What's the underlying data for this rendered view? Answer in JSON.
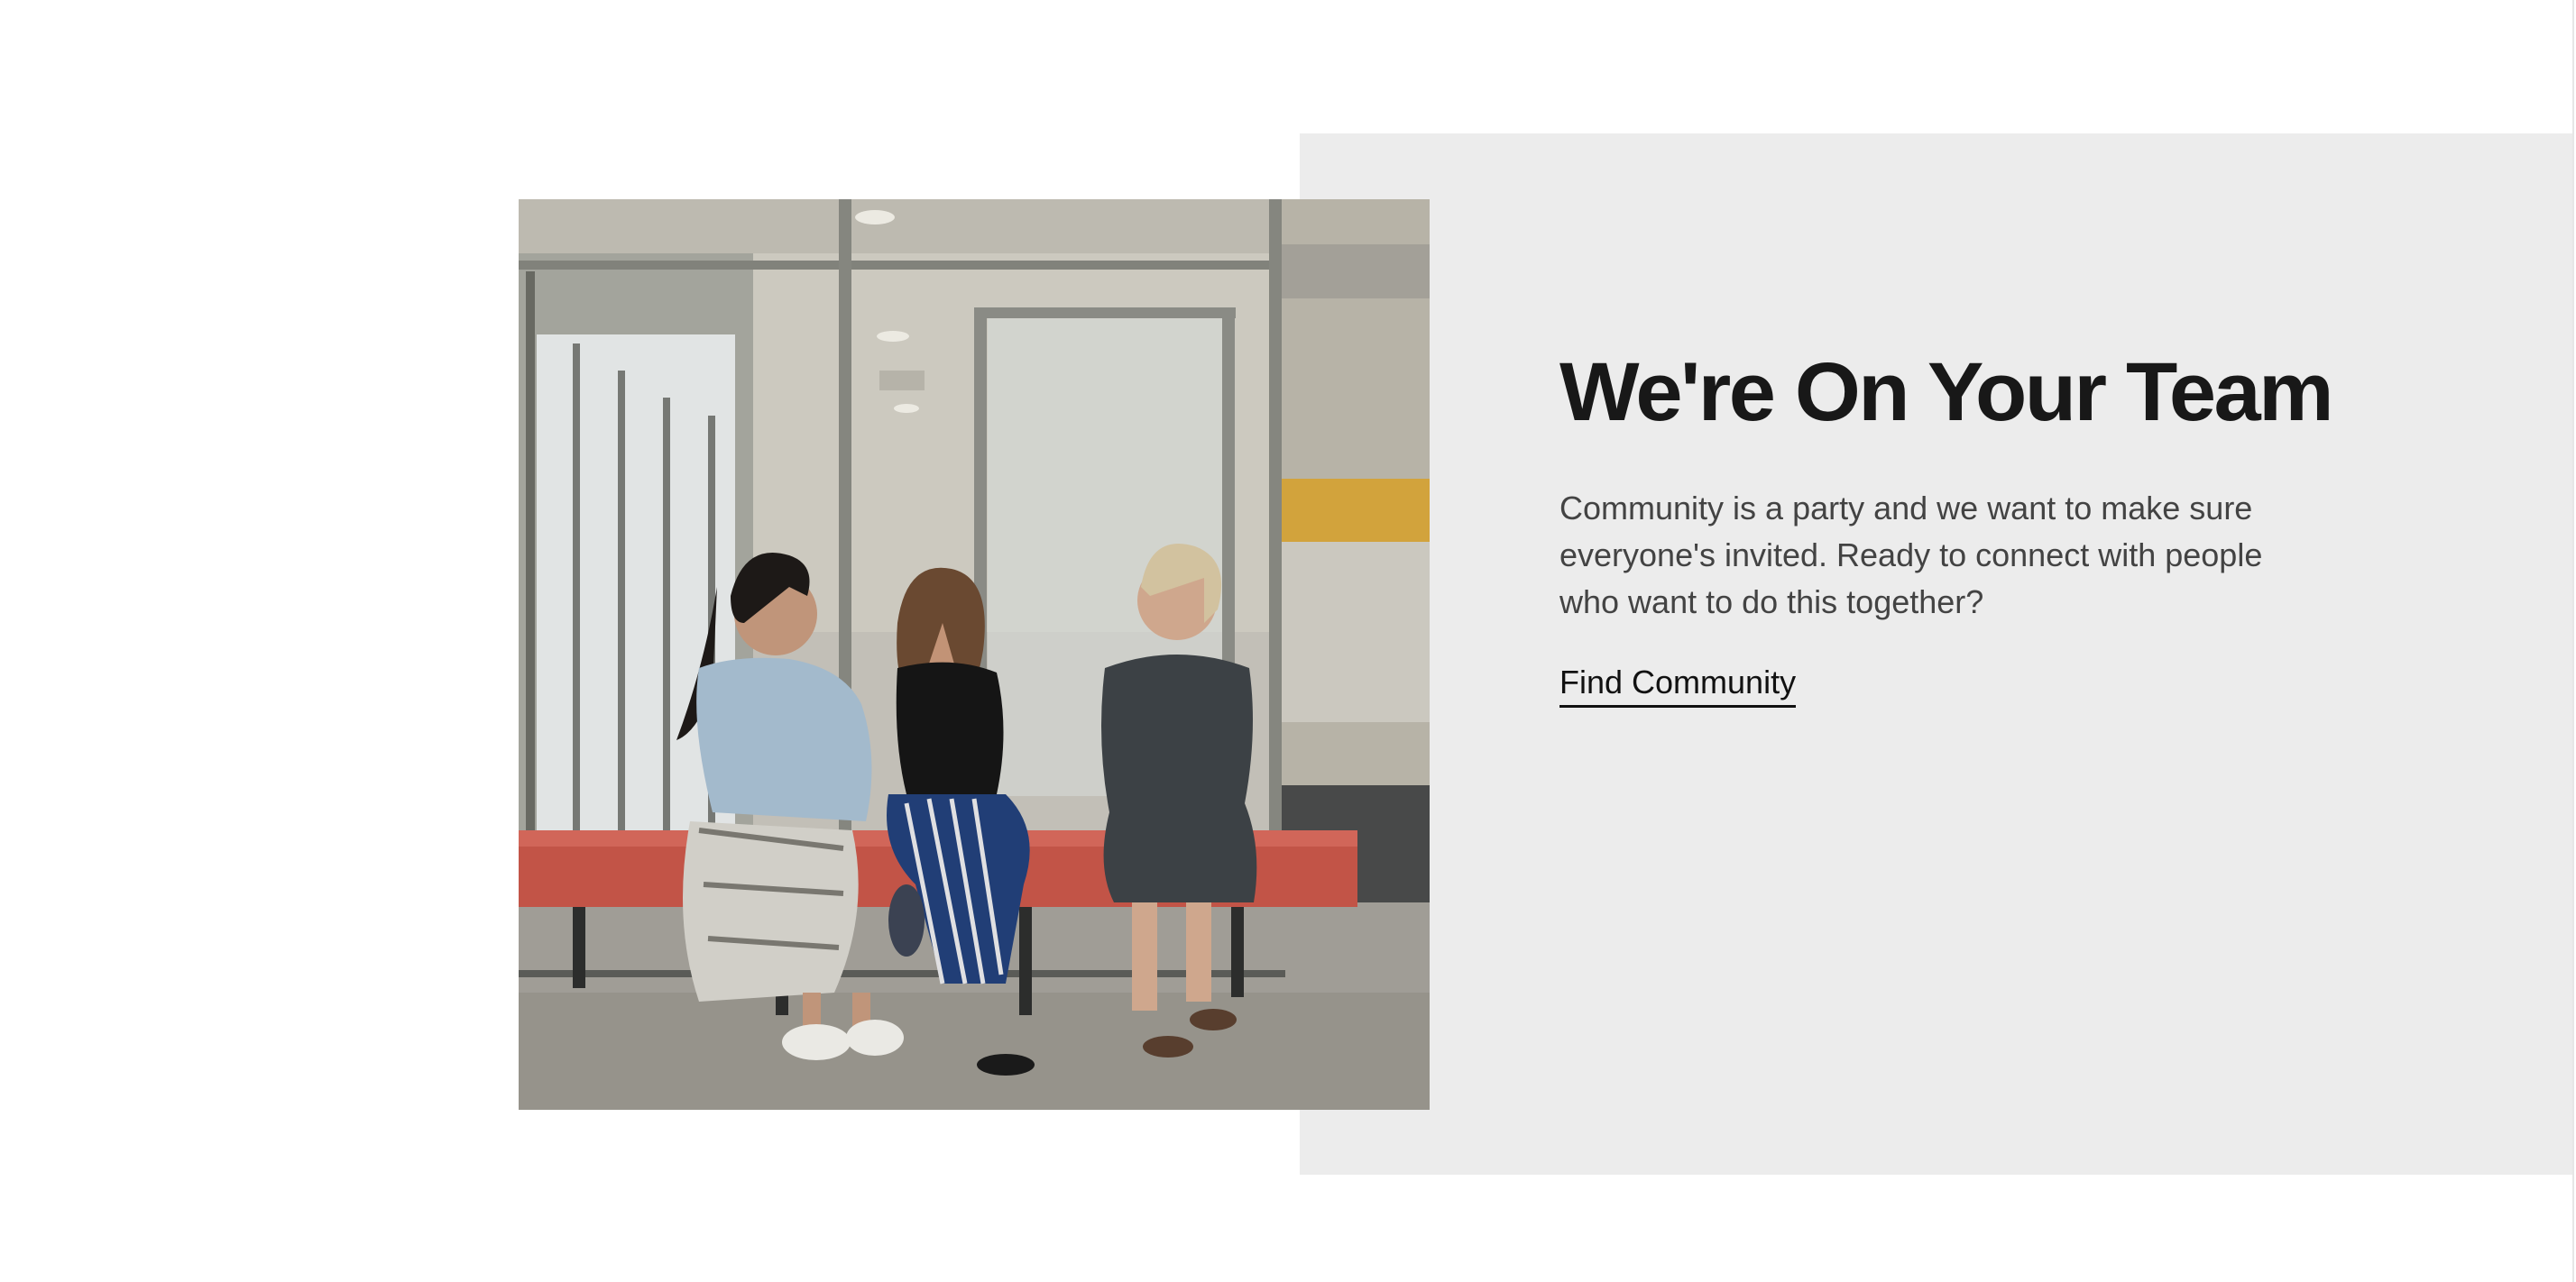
{
  "hero": {
    "headline": "We're On Your Team",
    "body": "Community is a party and we want to make sure everyone's invited. Ready to connect with people who want to do this together?",
    "cta_label": "Find Community"
  },
  "colors": {
    "panel_background": "#ececec",
    "headline": "#181818",
    "body_text": "#434343",
    "link": "#111111"
  }
}
